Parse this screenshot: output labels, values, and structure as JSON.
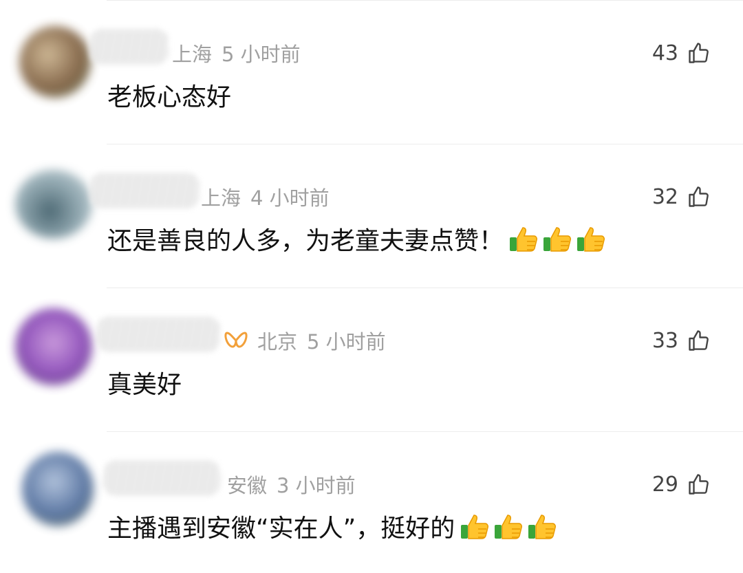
{
  "comments": [
    {
      "location": "上海",
      "time": "5 小时前",
      "likes": "43",
      "text": "老板心态好",
      "thumbs": 0,
      "avatar_colors": [
        "#7a5a3a",
        "#c9b08a",
        "#5c6b4a"
      ],
      "badge": false
    },
    {
      "location": "上海",
      "time": "4 小时前",
      "likes": "32",
      "text": "还是善良的人多，为老童夫妻点赞！",
      "thumbs": 3,
      "avatar_colors": [
        "#3b5a66",
        "#8fa7b0",
        "#c6d1d6"
      ],
      "badge": false
    },
    {
      "location": "北京",
      "time": "5 小时前",
      "likes": "33",
      "text": "真美好",
      "thumbs": 0,
      "avatar_colors": [
        "#4a2a6e",
        "#8b48b8",
        "#c38fd8"
      ],
      "badge": true
    },
    {
      "location": "安徽",
      "time": "3 小时前",
      "likes": "29",
      "text": "主播遇到安徽“实在人”，挺好的",
      "thumbs": 3,
      "avatar_colors": [
        "#4c6a9a",
        "#a9bcd8",
        "#5c6a58"
      ],
      "badge": false
    }
  ],
  "icons": {
    "like": "thumbs-up-outline-icon",
    "thumb_emoji": "thumbs-up-emoji-icon",
    "badge": "orange-ribbon-badge-icon"
  },
  "colors": {
    "meta": "#a0a0a0",
    "text": "#111111",
    "likes": "#444444",
    "divider": "#ececec",
    "badge": "#f2a03a"
  }
}
